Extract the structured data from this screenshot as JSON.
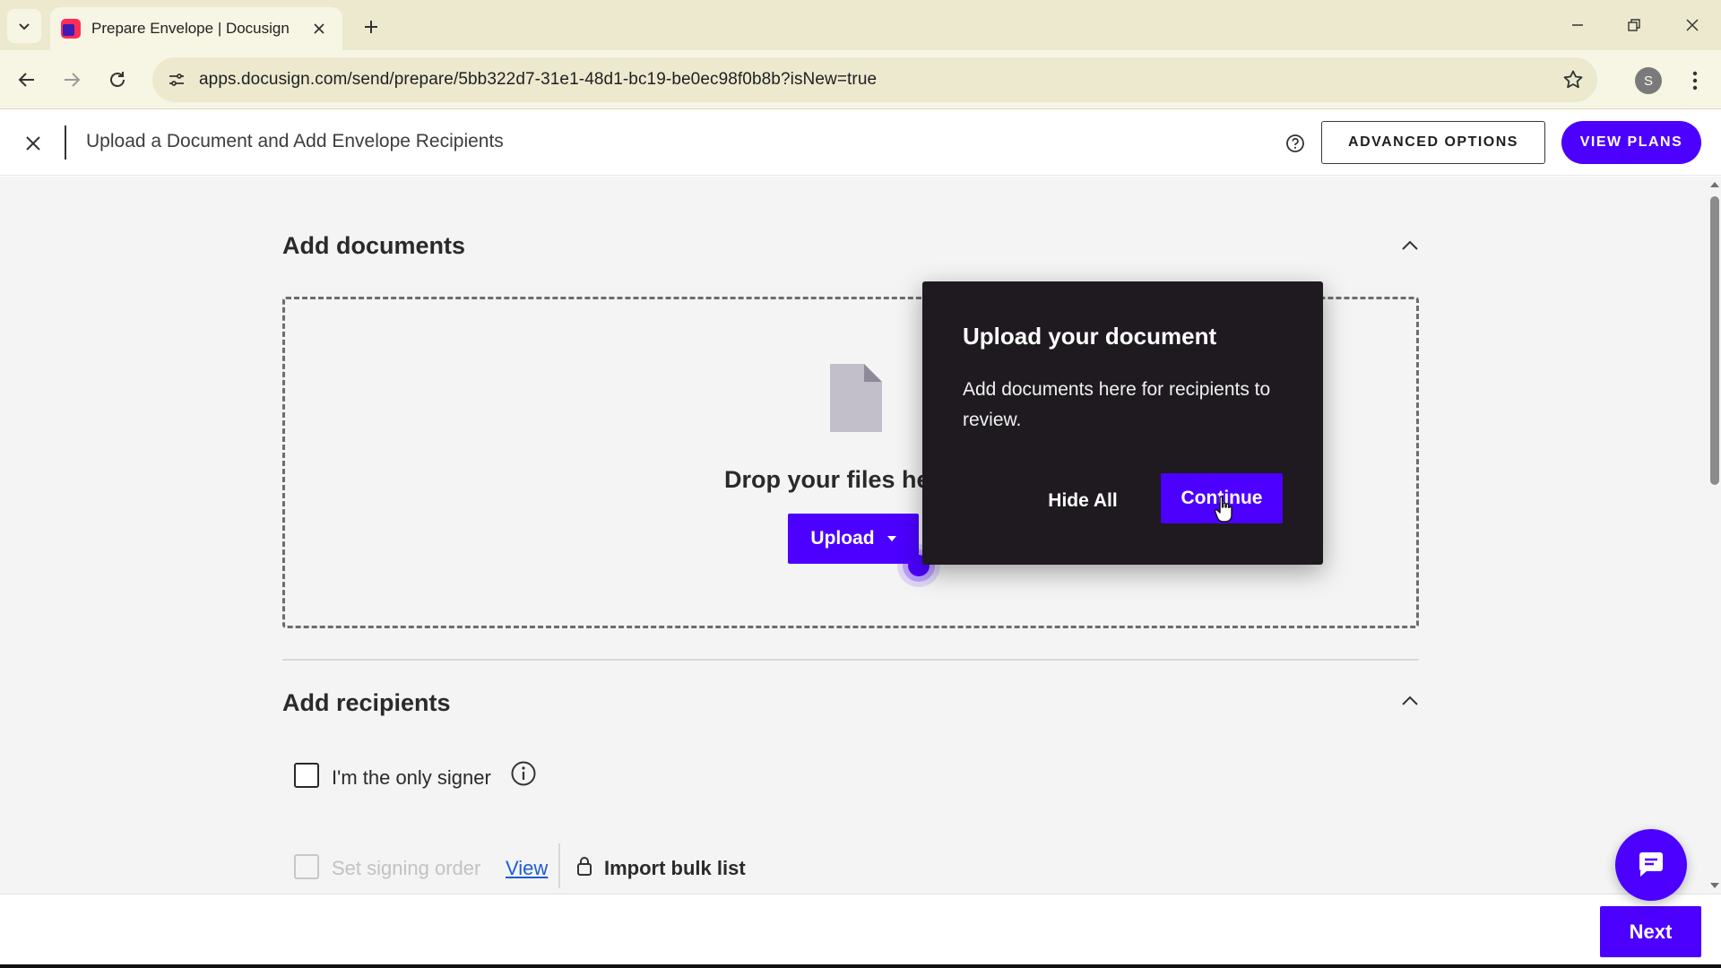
{
  "browser": {
    "tab_title": "Prepare Envelope | Docusign",
    "url": "apps.docusign.com/send/prepare/5bb322d7-31e1-48d1-bc19-be0ec98f0b8b?isNew=true",
    "profile_initial": "S"
  },
  "header": {
    "title": "Upload a Document and Add Envelope Recipients",
    "advanced_options": "ADVANCED OPTIONS",
    "view_plans": "VIEW PLANS"
  },
  "documents": {
    "title": "Add documents",
    "drop_text": "Drop your files he",
    "upload_label": "Upload"
  },
  "popover": {
    "title": "Upload your document",
    "body": "Add documents here for recipients to review.",
    "hide_all": "Hide All",
    "continue": "Continue"
  },
  "recipients": {
    "title": "Add recipients",
    "only_signer": "I'm the only signer",
    "signing_order": "Set signing order",
    "view": "View",
    "import_bulk": "Import bulk list"
  },
  "footer": {
    "next": "Next"
  },
  "colors": {
    "brand": "#4c00ff",
    "popover_bg": "#1e1a1f",
    "browser_chrome": "#ece9cf"
  }
}
